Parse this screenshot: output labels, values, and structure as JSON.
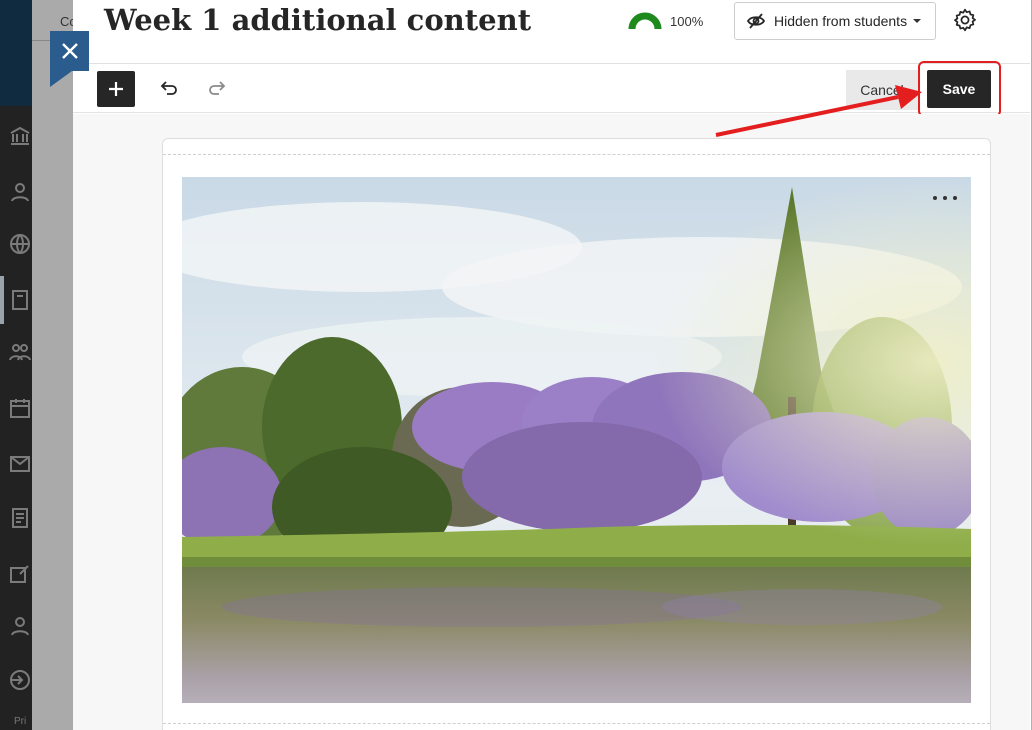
{
  "background": {
    "breadcrumb_fragment": "Co",
    "footer_fragment": "Pri"
  },
  "panel": {
    "title": "Week 1 additional content",
    "progress": {
      "value_percent": 100,
      "label": "100%"
    },
    "visibility": {
      "label": "Hidden from students"
    }
  },
  "toolbar": {
    "add_label": "+",
    "cancel_label": "Cancel",
    "save_label": "Save"
  },
  "colors": {
    "accent_close": "#2a5c8e",
    "progress_green": "#1e8a1e",
    "annotation_red": "#e41e1e",
    "dark_button": "#262626"
  },
  "icons": [
    "close-icon",
    "plus-icon",
    "undo-icon",
    "redo-icon",
    "hidden-eye-icon",
    "gear-icon",
    "more-options-icon"
  ]
}
